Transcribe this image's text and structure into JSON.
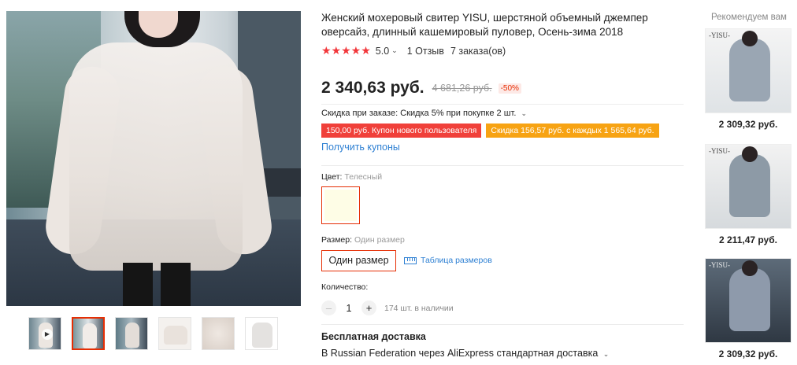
{
  "gallery": {
    "thumbnails": [
      {
        "label": "video",
        "has_play": true
      },
      {
        "label": "photo-2",
        "active": true
      },
      {
        "label": "photo-3"
      },
      {
        "label": "photo-4"
      },
      {
        "label": "photo-5"
      },
      {
        "label": "photo-6"
      }
    ]
  },
  "product": {
    "title": "Женский мохеровый свитер YISU, шерстяной объемный джемпер оверсайз, длинный кашемировый пуловер, Осень-зима 2018",
    "stars": "★★★★★",
    "rating": "5.0",
    "reviews": "1 Отзыв",
    "orders": "7 заказа(ов)",
    "price": "2 340,63 руб.",
    "old_price": "4 681,26 руб.",
    "discount": "-50%",
    "store_promo": "Скидка при заказе: Скидка 5% при покупке 2 шт.",
    "coupons": [
      "150,00 руб. Купон нового пользователя",
      "Скидка 156,57 руб. с каждых 1 565,64 руб."
    ],
    "get_coupons": "Получить купоны",
    "color_label": "Цвет:",
    "color_value": "Телесный",
    "size_label": "Размер:",
    "size_value": "Один размер",
    "size_option": "Один размер",
    "size_table": "Таблица размеров",
    "quantity_label": "Количество:",
    "quantity": "1",
    "minus": "–",
    "plus": "+",
    "stock": "174 шт. в наличии",
    "shipping_title": "Бесплатная доставка",
    "shipping_line": "В Russian Federation через AliExpress стандартная доставка"
  },
  "recommendations": {
    "title": "Рекомендуем вам",
    "items": [
      {
        "price": "2 309,32 руб.",
        "logo": "-YISU-"
      },
      {
        "price": "2 211,47 руб.",
        "logo": "-YISU-"
      },
      {
        "price": "2 309,32 руб.",
        "logo": "-YISU-"
      }
    ]
  },
  "colors": {
    "accent": "#e62e04",
    "link": "#2e80d3",
    "coupon_red": "#f0403a",
    "coupon_orange": "#f7a313",
    "star": "#f2363a"
  }
}
